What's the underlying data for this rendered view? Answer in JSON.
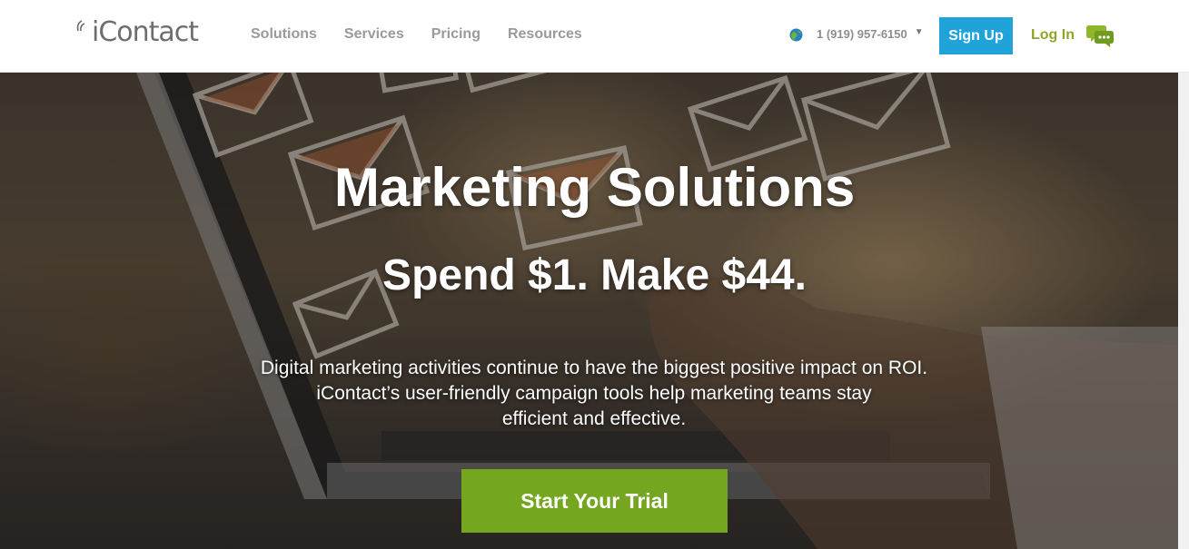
{
  "header": {
    "logo_text": "iContact",
    "nav": [
      {
        "label": "Solutions"
      },
      {
        "label": "Services"
      },
      {
        "label": "Pricing"
      },
      {
        "label": "Resources"
      }
    ],
    "phone": "1 (919) 957-6150",
    "caret": "▼",
    "signup_label": "Sign Up",
    "login_label": "Log In",
    "icons": [
      "logo-signal-icon",
      "globe-icon",
      "chevron-down-icon",
      "chat-bubbles-icon"
    ]
  },
  "hero": {
    "title": "Marketing Solutions",
    "subtitle": "Spend $1. Make $44.",
    "body_lines": [
      "Digital marketing activities continue to have the biggest positive impact on ROI.",
      "iContact’s user-friendly campaign tools help marketing teams stay",
      "efficient and effective."
    ],
    "cta_label": "Start Your Trial"
  },
  "colors": {
    "signup_bg": "#1fa3d9",
    "login_text": "#8fa52a",
    "cta_bg": "#74a61f",
    "nav_text": "#9a9a9a",
    "logo_text": "#6e6e6e"
  }
}
